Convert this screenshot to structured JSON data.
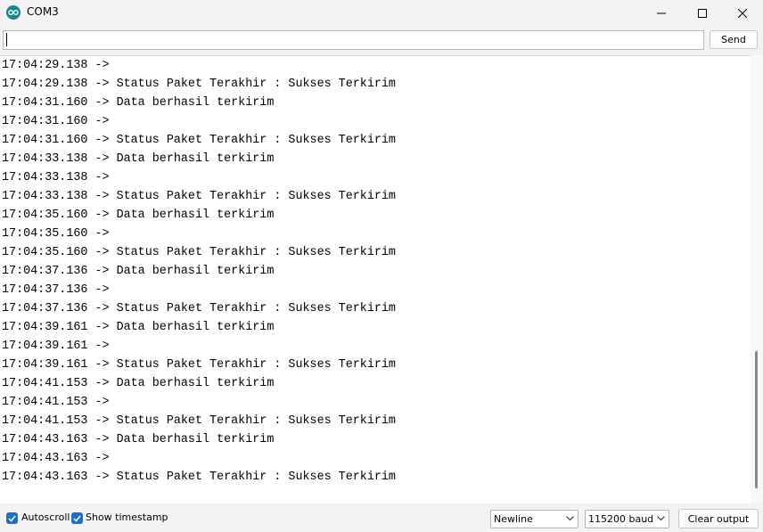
{
  "window": {
    "title": "COM3",
    "icon": "arduino-icon"
  },
  "send_bar": {
    "input_value": "",
    "send_label": "Send"
  },
  "output": {
    "lines": [
      "17:04:29.138 ->",
      "17:04:29.138 -> Status Paket Terakhir : Sukses Terkirim",
      "17:04:31.160 -> Data berhasil terkirim",
      "17:04:31.160 ->",
      "17:04:31.160 -> Status Paket Terakhir : Sukses Terkirim",
      "17:04:33.138 -> Data berhasil terkirim",
      "17:04:33.138 ->",
      "17:04:33.138 -> Status Paket Terakhir : Sukses Terkirim",
      "17:04:35.160 -> Data berhasil terkirim",
      "17:04:35.160 ->",
      "17:04:35.160 -> Status Paket Terakhir : Sukses Terkirim",
      "17:04:37.136 -> Data berhasil terkirim",
      "17:04:37.136 ->",
      "17:04:37.136 -> Status Paket Terakhir : Sukses Terkirim",
      "17:04:39.161 -> Data berhasil terkirim",
      "17:04:39.161 ->",
      "17:04:39.161 -> Status Paket Terakhir : Sukses Terkirim",
      "17:04:41.153 -> Data berhasil terkirim",
      "17:04:41.153 ->",
      "17:04:41.153 -> Status Paket Terakhir : Sukses Terkirim",
      "17:04:43.163 -> Data berhasil terkirim",
      "17:04:43.163 ->",
      "17:04:43.163 -> Status Paket Terakhir : Sukses Terkirim"
    ]
  },
  "status_bar": {
    "autoscroll_label": "Autoscroll",
    "autoscroll_checked": true,
    "timestamp_label": "Show timestamp",
    "timestamp_checked": true,
    "line_ending": "Newline",
    "baud_rate": "115200 baud",
    "clear_label": "Clear output"
  },
  "colors": {
    "accent": "#1f6fc8",
    "arduino": "#14868c"
  }
}
